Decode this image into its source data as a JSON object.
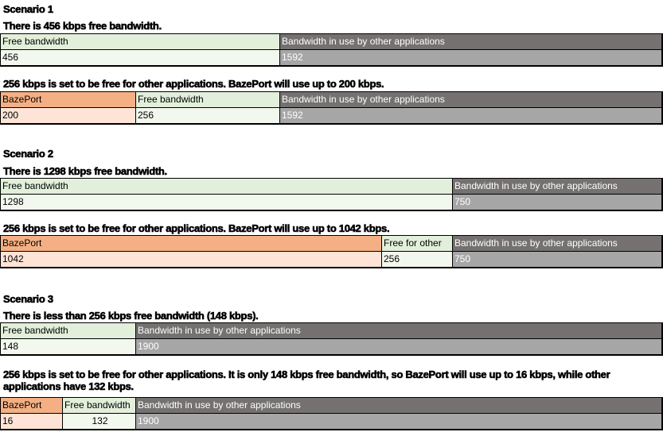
{
  "colors": {
    "bazeport_header": "#f4b084",
    "bazeport_value": "#fde4d6",
    "free_header": "#e2efda",
    "free_value": "#f3f8ee",
    "other_header": "#757171",
    "other_value": "#a6a6a6"
  },
  "scenarios": [
    {
      "title": "Scenario 1",
      "bars": [
        {
          "caption": "There is 456 kbps free bandwidth.",
          "cells": [
            {
              "type": "free",
              "label": "Free bandwidth",
              "value": "456"
            },
            {
              "type": "other",
              "label": "Bandwidth in use by other applications",
              "value": "1592"
            }
          ]
        },
        {
          "caption": "256 kbps is set to be free for other applications. BazePort will use up to 200 kbps.",
          "cells": [
            {
              "type": "bazeport",
              "label": "BazePort",
              "value": "200"
            },
            {
              "type": "free",
              "label": "Free bandwidth",
              "value": "256"
            },
            {
              "type": "other",
              "label": "Bandwidth in use by other applications",
              "value": "1592"
            }
          ]
        }
      ]
    },
    {
      "title": "Scenario 2",
      "bars": [
        {
          "caption": "There is 1298 kbps free bandwidth.",
          "cells": [
            {
              "type": "free",
              "label": "Free bandwidth",
              "value": "1298"
            },
            {
              "type": "other",
              "label": "Bandwidth in use by other applications",
              "value": "750"
            }
          ]
        },
        {
          "caption": "256 kbps is set to be free for other applications. BazePort will use up to 1042 kbps.",
          "cells": [
            {
              "type": "bazeport",
              "label": "BazePort",
              "value": "1042"
            },
            {
              "type": "free",
              "label": "Free for other",
              "value": "256"
            },
            {
              "type": "other",
              "label": "Bandwidth in use by other applications",
              "value": "750"
            }
          ]
        }
      ]
    },
    {
      "title": "Scenario 3",
      "bars": [
        {
          "caption": "There is less than 256 kbps free bandwidth (148 kbps).",
          "cells": [
            {
              "type": "free",
              "label": "Free bandwidth",
              "value": "148"
            },
            {
              "type": "other",
              "label": "Bandwidth in use by other applications",
              "value": "1900"
            }
          ]
        },
        {
          "caption": "256 kbps is set to be free for other applications. It is only 148 kbps free bandwidth, so BazePort will use up to 16 kbps, while other applications have 132 kbps.",
          "cells": [
            {
              "type": "bazeport",
              "label": "BazePort",
              "value": "16"
            },
            {
              "type": "free",
              "label": "Free bandwidth",
              "value": "132"
            },
            {
              "type": "other",
              "label": "Bandwidth in use by other applications",
              "value": "1900"
            }
          ]
        }
      ]
    }
  ]
}
